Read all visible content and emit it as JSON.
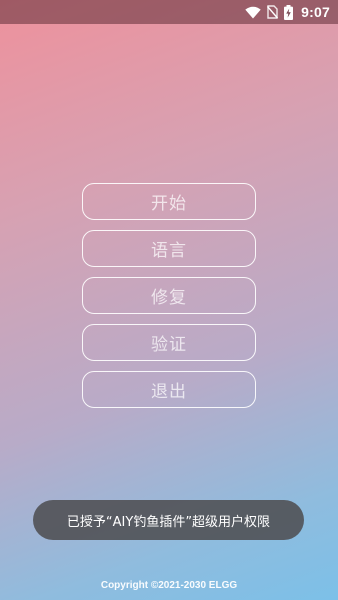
{
  "status_bar": {
    "time": "9:07",
    "icons": [
      "wifi-icon",
      "no-sim-icon",
      "battery-charging-icon"
    ]
  },
  "menu": {
    "buttons": [
      {
        "label": "开始"
      },
      {
        "label": "语言"
      },
      {
        "label": "修复"
      },
      {
        "label": "验证"
      },
      {
        "label": "退出"
      }
    ]
  },
  "toast": {
    "message": "已授予“AIY钓鱼插件”超级用户权限"
  },
  "footer": {
    "copyright": "Copyright ©2021-2030 ELGG"
  },
  "colors": {
    "gradient_top": "#ee919c",
    "gradient_bottom": "#7cc0e8",
    "toast_bg": "#4e4e52",
    "button_border": "#ffffff"
  }
}
